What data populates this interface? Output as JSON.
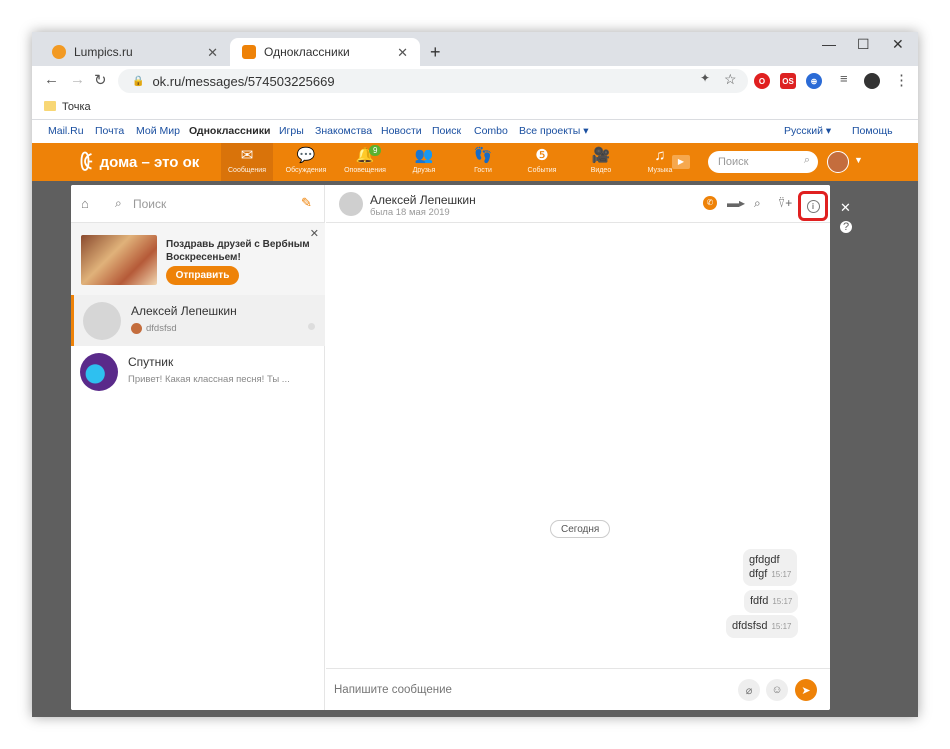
{
  "browser": {
    "tabs": [
      {
        "title": "Lumpics.ru",
        "active": false
      },
      {
        "title": "Одноклассники",
        "active": true
      }
    ],
    "url": "ok.ru/messages/574503225669",
    "bookmark_folder": "Точка"
  },
  "mailbar": {
    "links": [
      "Mail.Ru",
      "Почта",
      "Мой Мир",
      "Одноклассники",
      "Игры",
      "Знакомства",
      "Новости",
      "Поиск",
      "Combo",
      "Все проекты ▾"
    ],
    "language": "Русский ▾",
    "help": "Помощь"
  },
  "okbar": {
    "logo_text": "дома – это ок",
    "nav": [
      {
        "label": "Сообщения",
        "icon": "envelope-icon",
        "active": true
      },
      {
        "label": "Обсуждения",
        "icon": "chat-bubbles-icon"
      },
      {
        "label": "Оповещения",
        "icon": "bell-icon",
        "badge": "9"
      },
      {
        "label": "Друзья",
        "icon": "friends-icon"
      },
      {
        "label": "Гости",
        "icon": "footprints-icon"
      },
      {
        "label": "События",
        "icon": "events-icon"
      },
      {
        "label": "Видео",
        "icon": "video-icon"
      },
      {
        "label": "Музыка",
        "icon": "music-icon"
      }
    ],
    "search_placeholder": "Поиск"
  },
  "messenger": {
    "search_placeholder": "Поиск",
    "promo": {
      "text": "Поздравь друзей с Вербным Воскресеньем!",
      "button": "Отправить"
    },
    "chats": [
      {
        "name": "Алексей Лепешкин",
        "preview": "dfdsfsd",
        "selected": true
      },
      {
        "name": "Спутник",
        "preview": "Привет! Какая классная песня! Ты ...",
        "selected": false
      }
    ],
    "conversation": {
      "name": "Алексей Лепешкин",
      "status": "была 18 мая 2019",
      "date_separator": "Сегодня",
      "messages": [
        {
          "line1": "gfdgdf",
          "line2": "dfgf",
          "time": "15:17"
        },
        {
          "line1": "fdfd",
          "time": "15:17"
        },
        {
          "line1": "dfdsfsd",
          "time": "15:17"
        }
      ],
      "composer_placeholder": "Напишите сообщение"
    }
  },
  "colors": {
    "ok_orange": "#ee8208",
    "highlight_red": "#e02020"
  }
}
